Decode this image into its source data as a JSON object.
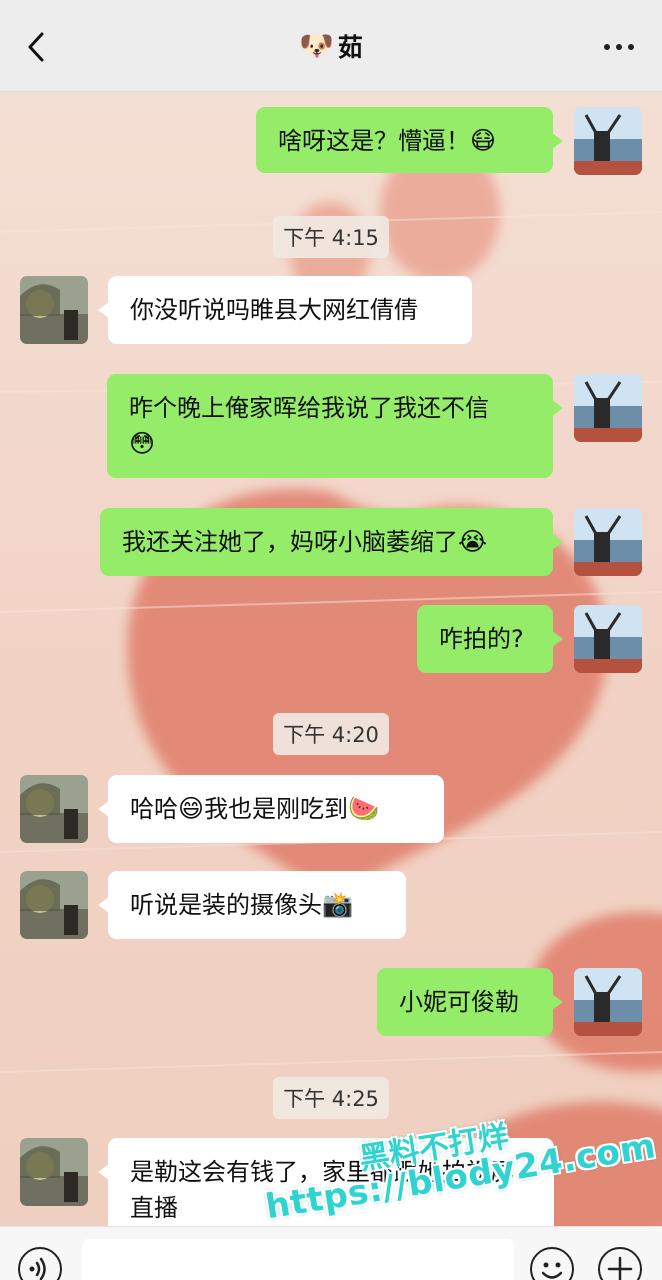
{
  "header": {
    "title_emoji": "🐶",
    "title": "茹"
  },
  "timestamps": [
    "下午 4:15",
    "下午 4:20",
    "下午 4:25"
  ],
  "messages": [
    {
      "side": "me",
      "text": "啥呀这是？懵逼！",
      "emoji": "😷"
    },
    {
      "side": "them",
      "text": "你没听说吗睢县大网红倩倩"
    },
    {
      "side": "me",
      "text": "昨个晚上俺家晖给我说了我还不信",
      "emoji": "😳"
    },
    {
      "side": "me",
      "text": "我还关注她了，妈呀小脑萎缩了",
      "emoji": "😭"
    },
    {
      "side": "me",
      "text": "咋拍的?"
    },
    {
      "side": "them",
      "text": "哈哈",
      "emoji": "😄",
      "text2": "我也是刚吃到",
      "emoji2": "🍉"
    },
    {
      "side": "them",
      "text": "听说是装的摄像头",
      "emoji": "📸"
    },
    {
      "side": "me",
      "text": "小妮可俊勒"
    },
    {
      "side": "them",
      "text": "是勒这会有钱了，家里都跟她拍视屏直播"
    }
  ],
  "watermark": {
    "line1": "黑料不打烊",
    "line2": "https://blody24.com"
  },
  "colors": {
    "me_bubble": "#95ec69",
    "them_bubble": "#ffffff",
    "header_bg": "#ededed",
    "watermark": "#2fd3d0"
  },
  "icons": {
    "back": "chevron-left-icon",
    "more": "more-dots-icon",
    "voice": "voice-icon",
    "emoji": "smiley-icon",
    "plus": "plus-icon"
  }
}
